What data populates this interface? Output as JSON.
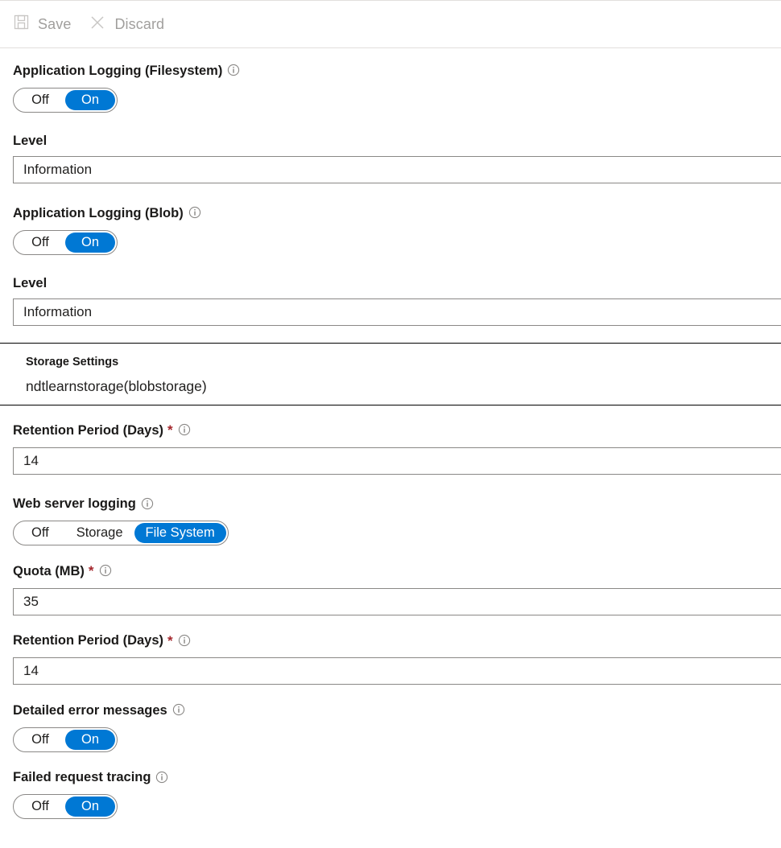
{
  "toolbar": {
    "save": {
      "label": "Save",
      "icon": "save-icon",
      "enabled": false
    },
    "discard": {
      "label": "Discard",
      "icon": "close-icon",
      "enabled": false
    }
  },
  "colors": {
    "accent": "#0078d4",
    "required_asterisk": "#a4262c",
    "disabled_text": "#a19f9d",
    "border": "#8a8886",
    "text": "#201f1e"
  },
  "form": {
    "app_logging_filesystem": {
      "label": "Application Logging (Filesystem)",
      "info_icon": "info-icon",
      "options": [
        "Off",
        "On"
      ],
      "value": "On"
    },
    "filesystem_level": {
      "label": "Level",
      "value": "Information"
    },
    "app_logging_blob": {
      "label": "Application Logging (Blob)",
      "info_icon": "info-icon",
      "options": [
        "Off",
        "On"
      ],
      "value": "On"
    },
    "blob_level": {
      "label": "Level",
      "value": "Information"
    },
    "storage_settings": {
      "label": "Storage Settings",
      "value": "ndtlearnstorage(blobstorage)"
    },
    "blob_retention": {
      "label": "Retention Period (Days)",
      "required": "*",
      "info_icon": "info-icon",
      "value": "14"
    },
    "web_server_logging": {
      "label": "Web server logging",
      "info_icon": "info-icon",
      "options": [
        "Off",
        "Storage",
        "File System"
      ],
      "value": "File System"
    },
    "quota": {
      "label": "Quota (MB)",
      "required": "*",
      "info_icon": "info-icon",
      "value": "35"
    },
    "web_retention": {
      "label": "Retention Period (Days)",
      "required": "*",
      "info_icon": "info-icon",
      "value": "14"
    },
    "detailed_error_messages": {
      "label": "Detailed error messages",
      "info_icon": "info-icon",
      "options": [
        "Off",
        "On"
      ],
      "value": "On"
    },
    "failed_request_tracing": {
      "label": "Failed request tracing",
      "info_icon": "info-icon",
      "options": [
        "Off",
        "On"
      ],
      "value": "On"
    }
  }
}
